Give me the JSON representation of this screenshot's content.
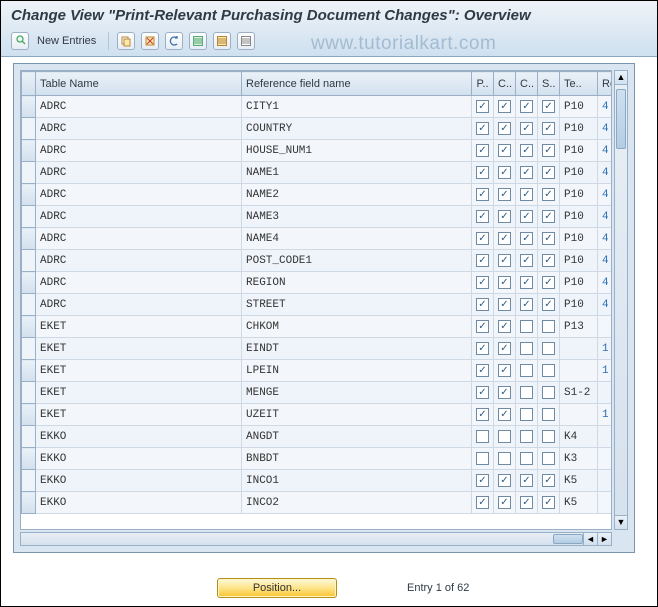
{
  "header": {
    "title": "Change View \"Print-Relevant Purchasing Document Changes\": Overview"
  },
  "toolbar": {
    "new_entries_label": "New Entries"
  },
  "watermark": "www.tutorialkart.com",
  "columns": {
    "table_name": "Table Name",
    "ref_field": "Reference field name",
    "p": "P..",
    "c1": "C..",
    "c2": "C..",
    "s": "S..",
    "te": "Te..",
    "ro": "Ro.."
  },
  "rows": [
    {
      "tn": "ADRC",
      "rf": "CITY1",
      "p": true,
      "c1": true,
      "c2": true,
      "s": true,
      "te": "P10",
      "ro": "4"
    },
    {
      "tn": "ADRC",
      "rf": "COUNTRY",
      "p": true,
      "c1": true,
      "c2": true,
      "s": true,
      "te": "P10",
      "ro": "4"
    },
    {
      "tn": "ADRC",
      "rf": "HOUSE_NUM1",
      "p": true,
      "c1": true,
      "c2": true,
      "s": true,
      "te": "P10",
      "ro": "4"
    },
    {
      "tn": "ADRC",
      "rf": "NAME1",
      "p": true,
      "c1": true,
      "c2": true,
      "s": true,
      "te": "P10",
      "ro": "4"
    },
    {
      "tn": "ADRC",
      "rf": "NAME2",
      "p": true,
      "c1": true,
      "c2": true,
      "s": true,
      "te": "P10",
      "ro": "4"
    },
    {
      "tn": "ADRC",
      "rf": "NAME3",
      "p": true,
      "c1": true,
      "c2": true,
      "s": true,
      "te": "P10",
      "ro": "4"
    },
    {
      "tn": "ADRC",
      "rf": "NAME4",
      "p": true,
      "c1": true,
      "c2": true,
      "s": true,
      "te": "P10",
      "ro": "4"
    },
    {
      "tn": "ADRC",
      "rf": "POST_CODE1",
      "p": true,
      "c1": true,
      "c2": true,
      "s": true,
      "te": "P10",
      "ro": "4"
    },
    {
      "tn": "ADRC",
      "rf": "REGION",
      "p": true,
      "c1": true,
      "c2": true,
      "s": true,
      "te": "P10",
      "ro": "4"
    },
    {
      "tn": "ADRC",
      "rf": "STREET",
      "p": true,
      "c1": true,
      "c2": true,
      "s": true,
      "te": "P10",
      "ro": "4"
    },
    {
      "tn": "EKET",
      "rf": "CHKOM",
      "p": true,
      "c1": true,
      "c2": false,
      "s": false,
      "te": "P13",
      "ro": ""
    },
    {
      "tn": "EKET",
      "rf": "EINDT",
      "p": true,
      "c1": true,
      "c2": false,
      "s": false,
      "te": "",
      "ro": "1"
    },
    {
      "tn": "EKET",
      "rf": "LPEIN",
      "p": true,
      "c1": true,
      "c2": false,
      "s": false,
      "te": "",
      "ro": "1"
    },
    {
      "tn": "EKET",
      "rf": "MENGE",
      "p": true,
      "c1": true,
      "c2": false,
      "s": false,
      "te": "S1-2",
      "ro": ""
    },
    {
      "tn": "EKET",
      "rf": "UZEIT",
      "p": true,
      "c1": true,
      "c2": false,
      "s": false,
      "te": "",
      "ro": "1"
    },
    {
      "tn": "EKKO",
      "rf": "ANGDT",
      "p": false,
      "c1": false,
      "c2": false,
      "s": false,
      "te": "K4",
      "ro": ""
    },
    {
      "tn": "EKKO",
      "rf": "BNBDT",
      "p": false,
      "c1": false,
      "c2": false,
      "s": false,
      "te": "K3",
      "ro": ""
    },
    {
      "tn": "EKKO",
      "rf": "INCO1",
      "p": true,
      "c1": true,
      "c2": true,
      "s": true,
      "te": "K5",
      "ro": ""
    },
    {
      "tn": "EKKO",
      "rf": "INCO2",
      "p": true,
      "c1": true,
      "c2": true,
      "s": true,
      "te": "K5",
      "ro": ""
    }
  ],
  "footer": {
    "position_label": "Position...",
    "entry_label": "Entry 1 of 62"
  }
}
